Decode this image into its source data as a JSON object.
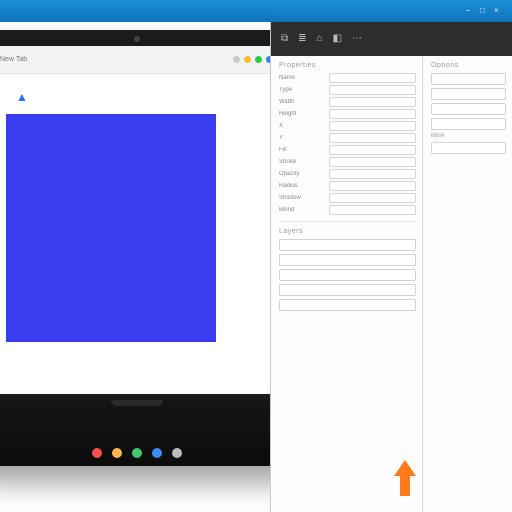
{
  "titlebar": {
    "appname": ""
  },
  "monitor": {
    "browser": {
      "tab": "New Tab",
      "traffic": [
        "min",
        "max",
        "close"
      ]
    },
    "page": {
      "alert_glyph": "▲",
      "canvas_color": "#3a3df0"
    },
    "dock_icons": [
      "app-1",
      "app-2",
      "app-3",
      "app-4",
      "app-5"
    ]
  },
  "right_pane": {
    "toolbar": [
      {
        "name": "tool-a",
        "glyph": "⧉",
        "label": ""
      },
      {
        "name": "tool-b",
        "glyph": "≣",
        "label": ""
      },
      {
        "name": "tool-c",
        "glyph": "⌂",
        "label": ""
      },
      {
        "name": "tool-d",
        "glyph": "◧",
        "label": ""
      },
      {
        "name": "tool-e",
        "glyph": "⋯",
        "label": ""
      }
    ],
    "section1_title": "Properties",
    "left_fields": [
      {
        "label": "Name",
        "value": ""
      },
      {
        "label": "Type",
        "value": ""
      },
      {
        "label": "Width",
        "value": ""
      },
      {
        "label": "Height",
        "value": ""
      },
      {
        "label": "X",
        "value": ""
      },
      {
        "label": "Y",
        "value": ""
      },
      {
        "label": "Fill",
        "value": ""
      },
      {
        "label": "Stroke",
        "value": ""
      },
      {
        "label": "Opacity",
        "value": ""
      },
      {
        "label": "Radius",
        "value": ""
      },
      {
        "label": "Shadow",
        "value": ""
      },
      {
        "label": "Blend",
        "value": ""
      }
    ],
    "left_footer_title": "Layers",
    "right_col": {
      "title": "Options",
      "slots": 4,
      "subtitle": "More"
    }
  },
  "annotation": {
    "arrow_color": "#ff7a1a"
  }
}
